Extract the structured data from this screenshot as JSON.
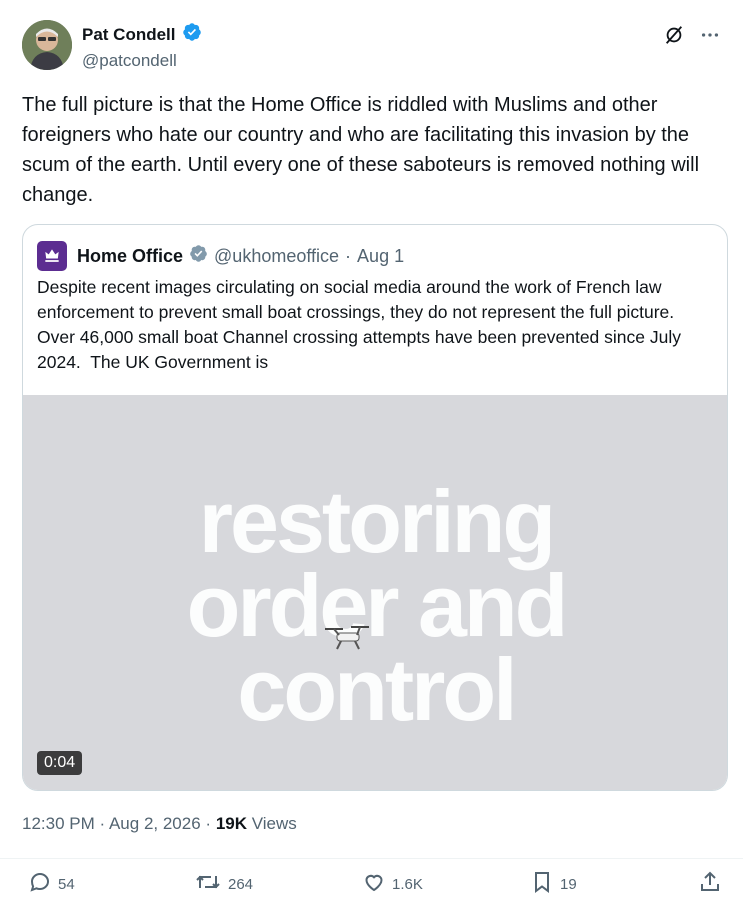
{
  "tweet": {
    "author": {
      "display_name": "Pat Condell",
      "handle": "@patcondell",
      "verified": true
    },
    "text": "The full picture is that the Home Office is riddled with Muslims and other foreigners who hate our country and who are facilitating this invasion by the scum of the earth. Until every one of these saboteurs is removed nothing will change.",
    "quoted": {
      "display_name": "Home Office",
      "handle": "@ukhomeoffice",
      "separator": "·",
      "date": "Aug 1",
      "text": "Despite recent images circulating on social media around the work of French law enforcement to prevent small boat crossings, they do not represent the full picture.    Over 46,000 small boat Channel crossing attempts have been prevented since July 2024.  The UK Government is",
      "video": {
        "overlay_lines": [
          "restoring",
          "order and",
          "control"
        ],
        "duration": "0:04"
      }
    },
    "meta": {
      "time": "12:30 PM",
      "sep1": "·",
      "date": "Aug 2, 2026",
      "sep2": "·",
      "views_count": "19K",
      "views_label": "Views"
    },
    "actions": {
      "replies": "54",
      "reposts": "264",
      "likes": "1.6K",
      "bookmarks": "19"
    }
  },
  "colors": {
    "verified": "#1d9bf0",
    "home_office_brand": "#5c2d91",
    "secondary_text": "#536471"
  }
}
